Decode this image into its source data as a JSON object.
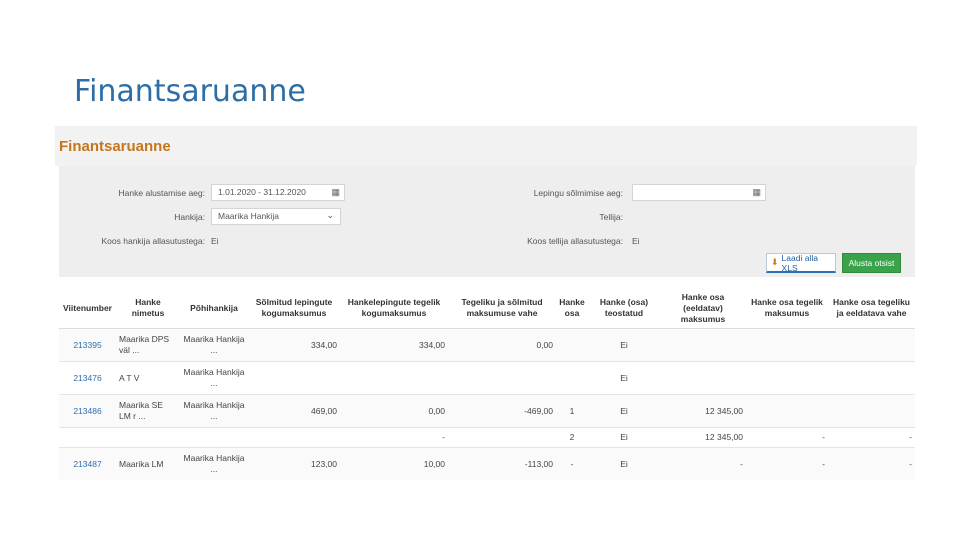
{
  "slide": {
    "title": "Finantsaruanne"
  },
  "report": {
    "title": "Finantsaruanne",
    "filters": {
      "start_label": "Hanke alustamise aeg:",
      "start_value": "1.01.2020 - 31.12.2020",
      "buyer_label": "Hankija:",
      "buyer_value": "Maarika Hankija",
      "joint_label": "Koos hankija allasutustega:",
      "joint_value": "Ei",
      "contract_label": "Lepingu sõlmimise aeg:",
      "contract_value": "",
      "supplier_label": "Tellija:",
      "supplier_value": "",
      "joint2_label": "Koos tellija allasutustega:",
      "joint2_value": "Ei"
    },
    "buttons": {
      "download": "Laadi alla XLS",
      "search": "Alusta otsist"
    },
    "columns": [
      "Viitenumber",
      "Hanke nimetus",
      "Põhihankija",
      "Sõlmitud lepingute kogumaksumus",
      "Hankelepingute tegelik kogumaksumus",
      "Tegeliku ja sõlmitud maksumuse vahe",
      "Hanke osa",
      "Hanke (osa) teostatud",
      "Hanke osa (eeldatav) maksumus",
      "Hanke osa tegelik maksumus",
      "Hanke osa tegeliku ja eeldatava vahe"
    ],
    "rows": [
      {
        "ref": "213395",
        "name": "Maarika DPS väl ...",
        "main": "Maarika Hankija ...",
        "signed": "334,00",
        "actual": "334,00",
        "diff": "0,00",
        "part": "",
        "done": "Ei",
        "expected": "",
        "part_actual": "",
        "part_diff": ""
      },
      {
        "ref": "213476",
        "name": "A T V",
        "main": "Maarika Hankija ...",
        "signed": "",
        "actual": "",
        "diff": "",
        "part": "",
        "done": "Ei",
        "expected": "",
        "part_actual": "",
        "part_diff": ""
      },
      {
        "ref": "213486",
        "name": "Maarika SE LM r ...",
        "main": "Maarika Hankija ...",
        "signed": "469,00",
        "actual": "0,00",
        "diff": "-469,00",
        "part": "1",
        "done": "Ei",
        "expected": "12 345,00",
        "part_actual": "",
        "part_diff": ""
      },
      {
        "ref": "",
        "name": "",
        "main": "",
        "signed": "",
        "actual": "-",
        "diff": "",
        "part": "2",
        "done": "Ei",
        "expected": "12 345,00",
        "part_actual": "-",
        "part_diff": "-"
      },
      {
        "ref": "213487",
        "name": "Maarika LM",
        "main": "Maarika Hankija ...",
        "signed": "123,00",
        "actual": "10,00",
        "diff": "-113,00",
        "part": "-",
        "done": "Ei",
        "expected": "-",
        "part_actual": "-",
        "part_diff": "-"
      }
    ]
  }
}
